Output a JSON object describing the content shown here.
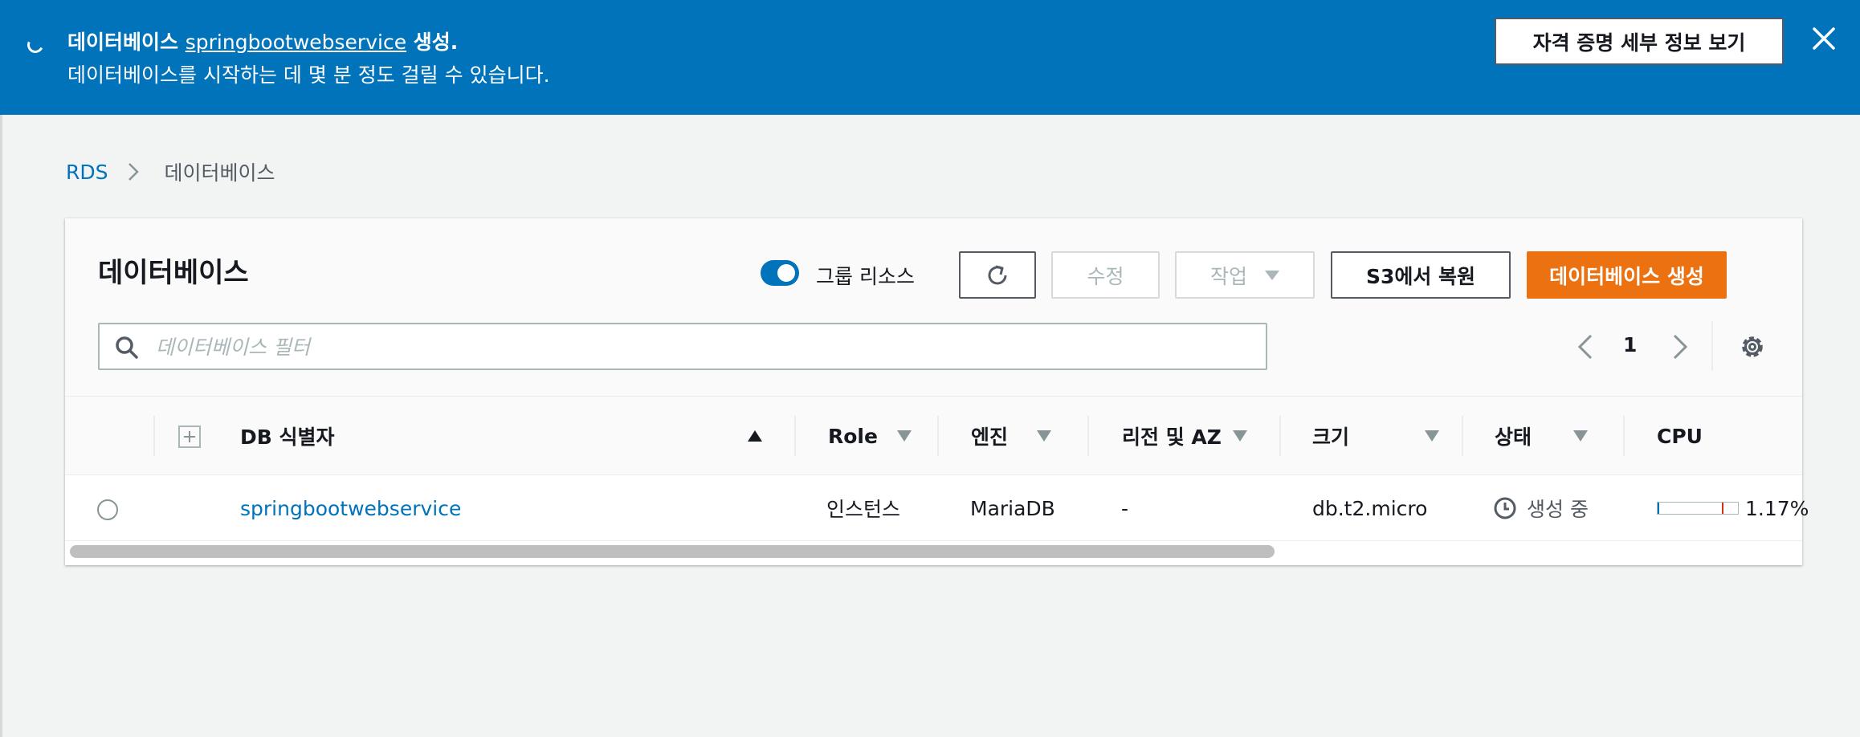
{
  "banner": {
    "line1_prefix": "데이터베이스",
    "db_name": "springbootwebservice",
    "line1_suffix": "생성.",
    "line2": "데이터베이스를 시작하는 데 몇 분 정도 걸릴 수 있습니다.",
    "cred_button": "자격 증명 세부 정보 보기",
    "bg_color": "#0073bb"
  },
  "breadcrumb": {
    "root": "RDS",
    "current": "데이터베이스"
  },
  "panel": {
    "title": "데이터베이스",
    "group_toggle_label": "그룹 리소스",
    "group_toggle_on": true,
    "edit_label": "수정",
    "actions_label": "작업",
    "restore_label": "S3에서 복원",
    "create_label": "데이터베이스 생성",
    "create_color": "#ec7211",
    "search_placeholder": "데이터베이스 필터",
    "page": "1"
  },
  "table": {
    "columns": {
      "db_id": "DB 식별자",
      "role": "Role",
      "engine": "엔진",
      "region": "리전 및 AZ",
      "size": "크기",
      "status": "상태",
      "cpu": "CPU"
    },
    "rows": [
      {
        "db_id": "springbootwebservice",
        "role": "인스턴스",
        "engine": "MariaDB",
        "region": "-",
        "size": "db.t2.micro",
        "status": "생성 중",
        "cpu": "1.17%",
        "cpu_fraction": 0.0117
      }
    ]
  }
}
